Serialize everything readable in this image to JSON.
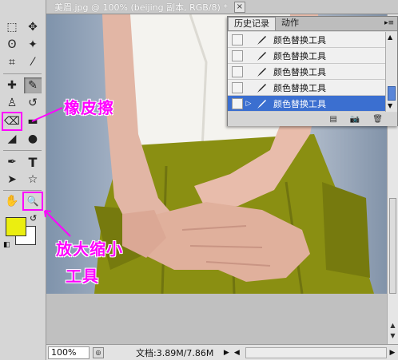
{
  "document": {
    "title": "美眉.jpg @ 100% (beijing 副本, RGB/8) *",
    "close_glyph": "×"
  },
  "toolbox": {
    "tools": [
      {
        "name": "marquee-tool-icon",
        "glyph": "⬚"
      },
      {
        "name": "move-tool-icon",
        "glyph": "✥"
      },
      {
        "name": "lasso-tool-icon",
        "glyph": "ʘ"
      },
      {
        "name": "magic-wand-tool-icon",
        "glyph": "✦"
      },
      {
        "name": "crop-tool-icon",
        "glyph": "⌗"
      },
      {
        "name": "eyedropper-tool-icon",
        "glyph": "⁄"
      },
      {
        "name": "healing-brush-tool-icon",
        "glyph": "✚"
      },
      {
        "name": "brush-tool-icon",
        "glyph": "✎"
      },
      {
        "name": "clone-stamp-tool-icon",
        "glyph": "♙"
      },
      {
        "name": "history-brush-tool-icon",
        "glyph": "↺"
      },
      {
        "name": "eraser-tool-icon",
        "glyph": "⌫"
      },
      {
        "name": "gradient-tool-icon",
        "glyph": "▬"
      },
      {
        "name": "blur-tool-icon",
        "glyph": "◢"
      },
      {
        "name": "dodge-tool-icon",
        "glyph": "●"
      },
      {
        "name": "pen-tool-icon",
        "glyph": "✒"
      },
      {
        "name": "type-tool-icon",
        "glyph": "T"
      },
      {
        "name": "path-selection-tool-icon",
        "glyph": "➤"
      },
      {
        "name": "shape-tool-icon",
        "glyph": "☆"
      },
      {
        "name": "hand-tool-icon",
        "glyph": "✋"
      },
      {
        "name": "zoom-tool-icon",
        "glyph": "🔍"
      }
    ],
    "foreground_color": "#ebee10",
    "background_color": "#ffffff",
    "swap_glyph": "↺",
    "default_glyph": "◧"
  },
  "history_panel": {
    "tabs": [
      "历史记录",
      "动作"
    ],
    "menu_glyph": "▸≡",
    "steps": [
      {
        "label": "颜色替换工具",
        "selected": false
      },
      {
        "label": "颜色替换工具",
        "selected": false
      },
      {
        "label": "颜色替换工具",
        "selected": false
      },
      {
        "label": "颜色替换工具",
        "selected": false
      },
      {
        "label": "颜色替换工具",
        "selected": true
      }
    ],
    "marker_glyph": "▷",
    "footer_buttons": [
      {
        "name": "new-document-from-state-icon",
        "glyph": "▤"
      },
      {
        "name": "snapshot-camera-icon",
        "glyph": "📷"
      },
      {
        "name": "trash-icon",
        "glyph": "🗑"
      }
    ]
  },
  "statusbar": {
    "zoom": "100%",
    "doc_info": "文档:3.89M/7.86M",
    "arrow": "▶",
    "left_arrow": "◀"
  },
  "annotations": {
    "eraser": "橡皮擦",
    "zoom_line1": "放大缩小",
    "zoom_line2": "工具"
  },
  "colors": {
    "annotation": "#ff00ff",
    "history_selected": "#3b6fd0",
    "skirt": "#8a8f12"
  }
}
